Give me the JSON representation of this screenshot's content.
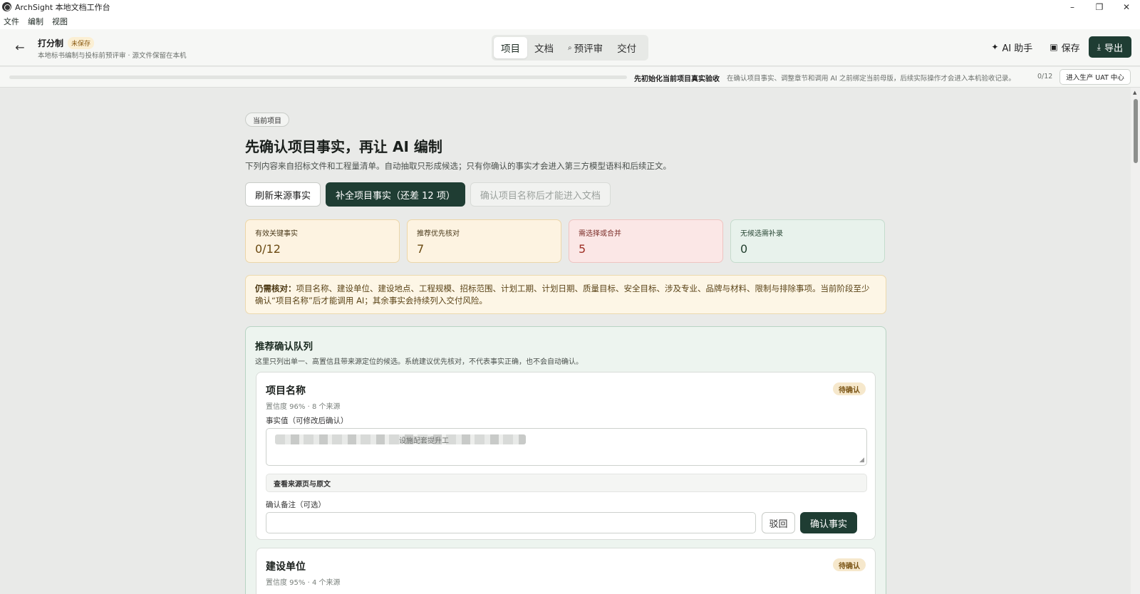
{
  "window": {
    "title": "ArchSight 本地文档工作台",
    "controls": [
      "–",
      "❐",
      "✕"
    ]
  },
  "menu": [
    "文件",
    "编制",
    "视图"
  ],
  "header": {
    "back_icon": "arrow-left-icon",
    "project_name": "打分制",
    "unsaved_label": "未保存",
    "subtitle": "本地标书编制与投标前预评审 · 源文件保留在本机",
    "tabs": [
      {
        "label": "项目",
        "active": true
      },
      {
        "label": "文档",
        "active": false
      },
      {
        "label": "预评审",
        "active": false,
        "icon": "search-icon"
      },
      {
        "label": "交付",
        "active": false
      }
    ],
    "actions": {
      "ai_label": "AI 助手",
      "save_label": "保存",
      "export_label": "导出"
    }
  },
  "status": {
    "progress": 0,
    "headline": "先初始化当前项目真实验收",
    "detail": "在确认项目事实、调整章节和调用 AI 之前绑定当前母版，后续实际操作才会进入本机验收记录。",
    "count": "0/12",
    "uat_label": "进入生产 UAT 中心"
  },
  "main": {
    "pill": "当前项目",
    "title": "先确认项目事实，再让 AI 编制",
    "desc": "下列内容来自招标文件和工程量清单。自动抽取只形成候选；只有你确认的事实才会进入第三方模型语料和后续正文。",
    "buttons": {
      "refresh": "刷新来源事实",
      "complete": "补全项目事实（还差 12 项）",
      "enter_doc": "确认项目名称后才能进入文档"
    },
    "stats": [
      {
        "label": "有效关键事实",
        "value": "0/12",
        "tone": "amber"
      },
      {
        "label": "推荐优先核对",
        "value": "7",
        "tone": "amber"
      },
      {
        "label": "需选择或合并",
        "value": "5",
        "tone": "red"
      },
      {
        "label": "无候选需补录",
        "value": "0",
        "tone": "green"
      }
    ],
    "notice": {
      "lead": "仍需核对：",
      "text": "项目名称、建设单位、建设地点、工程规模、招标范围、计划工期、计划日期、质量目标、安全目标、涉及专业、品牌与材料、限制与排除事项。当前阶段至少确认“项目名称”后才能调用 AI；其余事实会持续列入交付风险。"
    },
    "queue": {
      "title": "推荐确认队列",
      "desc": "这里只列出单一、高置信且带来源定位的候选。系统建议优先核对，不代表事实正确，也不会自动确认。",
      "cards": [
        {
          "title": "项目名称",
          "badge": "待确认",
          "meta": "置信度 96% · 8 个来源",
          "value_label": "事实值（可修改后确认）",
          "value_visible": "设施配套提升工",
          "source_label": "查看来源页与原文",
          "note_label": "确认备注（可选）",
          "reject_label": "驳回",
          "confirm_label": "确认事实"
        },
        {
          "title": "建设单位",
          "badge": "待确认",
          "meta": "置信度 95% · 4 个来源"
        }
      ]
    }
  },
  "colors": {
    "primary": "#1f3d33",
    "amber_bg": "#fdf3e1",
    "red_bg": "#fbe7e6",
    "green_bg": "#e8f2ec"
  }
}
